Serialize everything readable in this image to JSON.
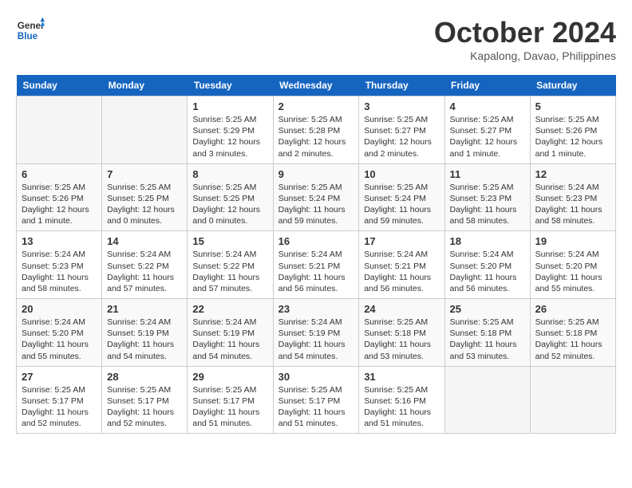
{
  "header": {
    "logo_line1": "General",
    "logo_line2": "Blue",
    "month": "October 2024",
    "location": "Kapalong, Davao, Philippines"
  },
  "weekdays": [
    "Sunday",
    "Monday",
    "Tuesday",
    "Wednesday",
    "Thursday",
    "Friday",
    "Saturday"
  ],
  "weeks": [
    [
      {
        "day": "",
        "info": ""
      },
      {
        "day": "",
        "info": ""
      },
      {
        "day": "1",
        "info": "Sunrise: 5:25 AM\nSunset: 5:29 PM\nDaylight: 12 hours\nand 3 minutes."
      },
      {
        "day": "2",
        "info": "Sunrise: 5:25 AM\nSunset: 5:28 PM\nDaylight: 12 hours\nand 2 minutes."
      },
      {
        "day": "3",
        "info": "Sunrise: 5:25 AM\nSunset: 5:27 PM\nDaylight: 12 hours\nand 2 minutes."
      },
      {
        "day": "4",
        "info": "Sunrise: 5:25 AM\nSunset: 5:27 PM\nDaylight: 12 hours\nand 1 minute."
      },
      {
        "day": "5",
        "info": "Sunrise: 5:25 AM\nSunset: 5:26 PM\nDaylight: 12 hours\nand 1 minute."
      }
    ],
    [
      {
        "day": "6",
        "info": "Sunrise: 5:25 AM\nSunset: 5:26 PM\nDaylight: 12 hours\nand 1 minute."
      },
      {
        "day": "7",
        "info": "Sunrise: 5:25 AM\nSunset: 5:25 PM\nDaylight: 12 hours\nand 0 minutes."
      },
      {
        "day": "8",
        "info": "Sunrise: 5:25 AM\nSunset: 5:25 PM\nDaylight: 12 hours\nand 0 minutes."
      },
      {
        "day": "9",
        "info": "Sunrise: 5:25 AM\nSunset: 5:24 PM\nDaylight: 11 hours\nand 59 minutes."
      },
      {
        "day": "10",
        "info": "Sunrise: 5:25 AM\nSunset: 5:24 PM\nDaylight: 11 hours\nand 59 minutes."
      },
      {
        "day": "11",
        "info": "Sunrise: 5:25 AM\nSunset: 5:23 PM\nDaylight: 11 hours\nand 58 minutes."
      },
      {
        "day": "12",
        "info": "Sunrise: 5:24 AM\nSunset: 5:23 PM\nDaylight: 11 hours\nand 58 minutes."
      }
    ],
    [
      {
        "day": "13",
        "info": "Sunrise: 5:24 AM\nSunset: 5:23 PM\nDaylight: 11 hours\nand 58 minutes."
      },
      {
        "day": "14",
        "info": "Sunrise: 5:24 AM\nSunset: 5:22 PM\nDaylight: 11 hours\nand 57 minutes."
      },
      {
        "day": "15",
        "info": "Sunrise: 5:24 AM\nSunset: 5:22 PM\nDaylight: 11 hours\nand 57 minutes."
      },
      {
        "day": "16",
        "info": "Sunrise: 5:24 AM\nSunset: 5:21 PM\nDaylight: 11 hours\nand 56 minutes."
      },
      {
        "day": "17",
        "info": "Sunrise: 5:24 AM\nSunset: 5:21 PM\nDaylight: 11 hours\nand 56 minutes."
      },
      {
        "day": "18",
        "info": "Sunrise: 5:24 AM\nSunset: 5:20 PM\nDaylight: 11 hours\nand 56 minutes."
      },
      {
        "day": "19",
        "info": "Sunrise: 5:24 AM\nSunset: 5:20 PM\nDaylight: 11 hours\nand 55 minutes."
      }
    ],
    [
      {
        "day": "20",
        "info": "Sunrise: 5:24 AM\nSunset: 5:20 PM\nDaylight: 11 hours\nand 55 minutes."
      },
      {
        "day": "21",
        "info": "Sunrise: 5:24 AM\nSunset: 5:19 PM\nDaylight: 11 hours\nand 54 minutes."
      },
      {
        "day": "22",
        "info": "Sunrise: 5:24 AM\nSunset: 5:19 PM\nDaylight: 11 hours\nand 54 minutes."
      },
      {
        "day": "23",
        "info": "Sunrise: 5:24 AM\nSunset: 5:19 PM\nDaylight: 11 hours\nand 54 minutes."
      },
      {
        "day": "24",
        "info": "Sunrise: 5:25 AM\nSunset: 5:18 PM\nDaylight: 11 hours\nand 53 minutes."
      },
      {
        "day": "25",
        "info": "Sunrise: 5:25 AM\nSunset: 5:18 PM\nDaylight: 11 hours\nand 53 minutes."
      },
      {
        "day": "26",
        "info": "Sunrise: 5:25 AM\nSunset: 5:18 PM\nDaylight: 11 hours\nand 52 minutes."
      }
    ],
    [
      {
        "day": "27",
        "info": "Sunrise: 5:25 AM\nSunset: 5:17 PM\nDaylight: 11 hours\nand 52 minutes."
      },
      {
        "day": "28",
        "info": "Sunrise: 5:25 AM\nSunset: 5:17 PM\nDaylight: 11 hours\nand 52 minutes."
      },
      {
        "day": "29",
        "info": "Sunrise: 5:25 AM\nSunset: 5:17 PM\nDaylight: 11 hours\nand 51 minutes."
      },
      {
        "day": "30",
        "info": "Sunrise: 5:25 AM\nSunset: 5:17 PM\nDaylight: 11 hours\nand 51 minutes."
      },
      {
        "day": "31",
        "info": "Sunrise: 5:25 AM\nSunset: 5:16 PM\nDaylight: 11 hours\nand 51 minutes."
      },
      {
        "day": "",
        "info": ""
      },
      {
        "day": "",
        "info": ""
      }
    ]
  ]
}
